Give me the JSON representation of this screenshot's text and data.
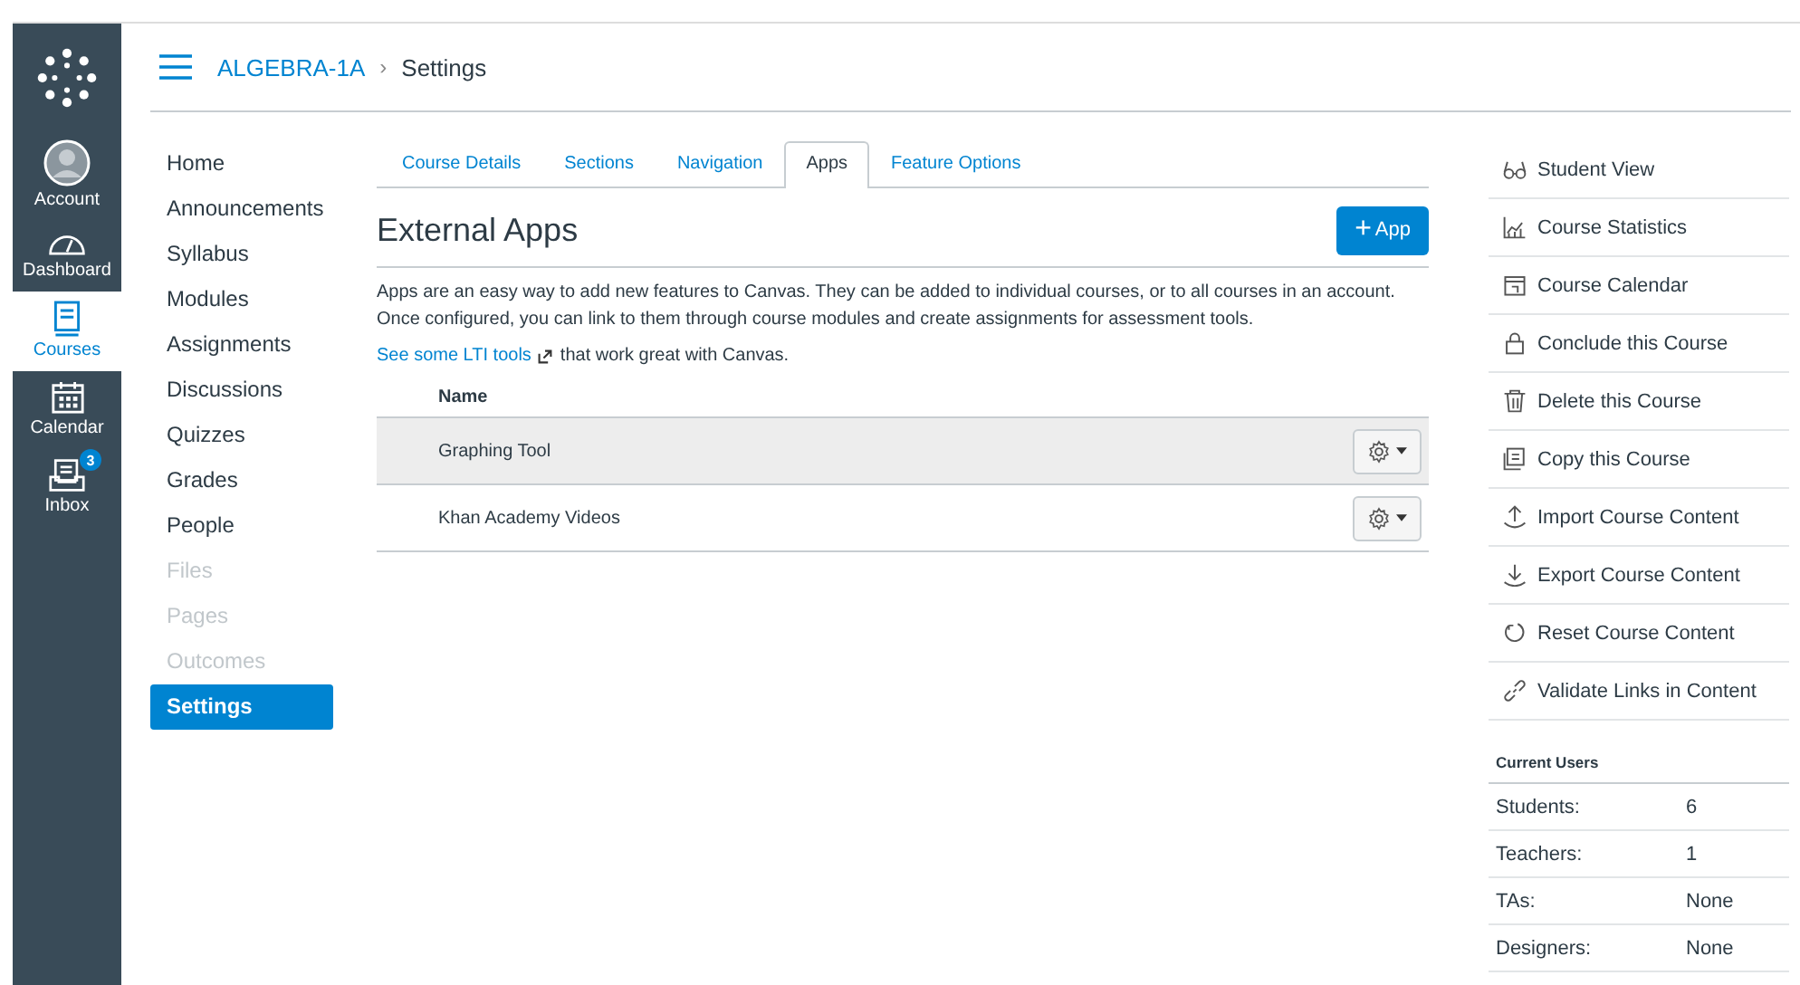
{
  "global_nav": [
    {
      "label": "Account",
      "kind": "account",
      "selected": false
    },
    {
      "label": "Dashboard",
      "kind": "dashboard",
      "selected": false
    },
    {
      "label": "Courses",
      "kind": "courses",
      "selected": true
    },
    {
      "label": "Calendar",
      "kind": "calendar",
      "selected": false
    },
    {
      "label": "Inbox",
      "kind": "inbox",
      "selected": false,
      "badge": "3"
    }
  ],
  "breadcrumb": {
    "course": "ALGEBRA-1A",
    "separator": "›",
    "page": "Settings"
  },
  "course_nav": [
    {
      "label": "Home",
      "disabled": false,
      "selected": false
    },
    {
      "label": "Announcements",
      "disabled": false,
      "selected": false
    },
    {
      "label": "Syllabus",
      "disabled": false,
      "selected": false
    },
    {
      "label": "Modules",
      "disabled": false,
      "selected": false
    },
    {
      "label": "Assignments",
      "disabled": false,
      "selected": false
    },
    {
      "label": "Discussions",
      "disabled": false,
      "selected": false
    },
    {
      "label": "Quizzes",
      "disabled": false,
      "selected": false
    },
    {
      "label": "Grades",
      "disabled": false,
      "selected": false
    },
    {
      "label": "People",
      "disabled": false,
      "selected": false
    },
    {
      "label": "Files",
      "disabled": true,
      "selected": false
    },
    {
      "label": "Pages",
      "disabled": true,
      "selected": false
    },
    {
      "label": "Outcomes",
      "disabled": true,
      "selected": false
    },
    {
      "label": "Settings",
      "disabled": false,
      "selected": true
    }
  ],
  "tabs": [
    {
      "label": "Course Details",
      "selected": false
    },
    {
      "label": "Sections",
      "selected": false
    },
    {
      "label": "Navigation",
      "selected": false
    },
    {
      "label": "Apps",
      "selected": true
    },
    {
      "label": "Feature Options",
      "selected": false
    }
  ],
  "heading": "External Apps",
  "add_button": {
    "icon": "+",
    "label": "App"
  },
  "description": "Apps are an easy way to add new features to Canvas. They can be added to individual courses, or to all courses in an account. Once configured, you can link to them through course modules and create assignments for assessment tools.",
  "lti": {
    "link": "See some LTI tools",
    "rest": "that work great with Canvas."
  },
  "apps_table": {
    "columns": [
      "Name"
    ],
    "rows": [
      {
        "name": "Graphing Tool",
        "selected": true
      },
      {
        "name": "Khan Academy Videos",
        "selected": false
      }
    ]
  },
  "actions": [
    {
      "label": "Student View",
      "kind": "glasses"
    },
    {
      "label": "Course Statistics",
      "kind": "stats"
    },
    {
      "label": "Course Calendar",
      "kind": "calendar"
    },
    {
      "label": "Conclude this Course",
      "kind": "lock"
    },
    {
      "label": "Delete this Course",
      "kind": "trash"
    },
    {
      "label": "Copy this Course",
      "kind": "copy"
    },
    {
      "label": "Import Course Content",
      "kind": "import"
    },
    {
      "label": "Export Course Content",
      "kind": "export"
    },
    {
      "label": "Reset Course Content",
      "kind": "reset"
    },
    {
      "label": "Validate Links in Content",
      "kind": "link"
    }
  ],
  "current_users": {
    "title": "Current Users",
    "rows": [
      {
        "role": "Students:",
        "count": "6"
      },
      {
        "role": "Teachers:",
        "count": "1"
      },
      {
        "role": "TAs:",
        "count": "None"
      },
      {
        "role": "Designers:",
        "count": "None"
      }
    ]
  }
}
